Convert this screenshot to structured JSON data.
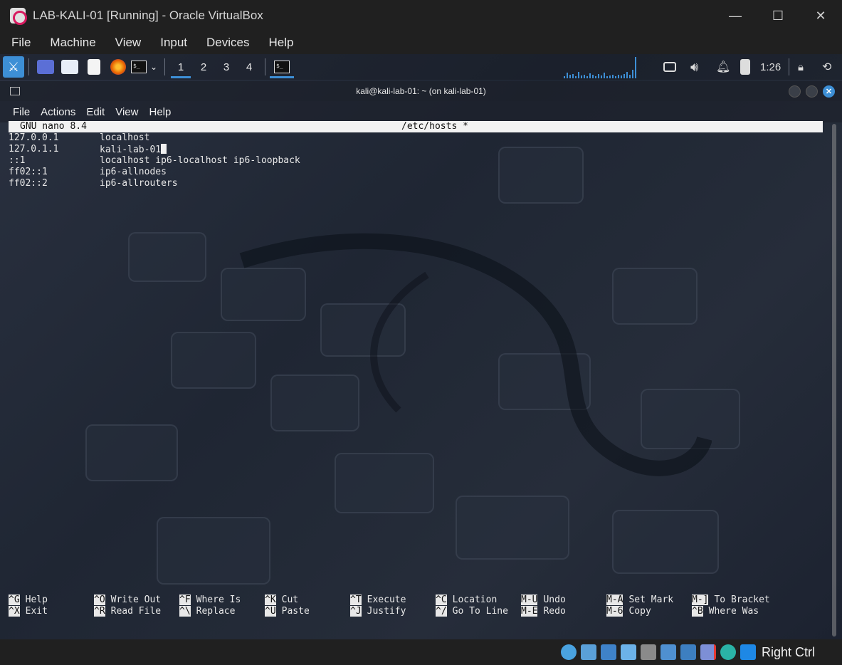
{
  "window": {
    "title": "LAB-KALI-01 [Running] - Oracle VirtualBox",
    "buttons": [
      "—",
      "☐",
      "✕"
    ]
  },
  "host_menu": [
    "File",
    "Machine",
    "View",
    "Input",
    "Devices",
    "Help"
  ],
  "panel": {
    "workspaces": [
      "1",
      "2",
      "3",
      "4"
    ],
    "clock": "1:26",
    "cpu_graph_levels": [
      0.1,
      0.25,
      0.15,
      0.2,
      0.1,
      0.3,
      0.12,
      0.18,
      0.1,
      0.22,
      0.15,
      0.1,
      0.2,
      0.14,
      0.25,
      0.1,
      0.12,
      0.18,
      0.1,
      0.15,
      0.12,
      0.2,
      0.3,
      0.15,
      0.4,
      1.0
    ]
  },
  "terminal": {
    "title": "kali@kali-lab-01: ~ (on kali-lab-01)",
    "menu": [
      "File",
      "Actions",
      "Edit",
      "View",
      "Help"
    ]
  },
  "nano": {
    "version": "GNU nano 8.4",
    "filename": "/etc/hosts *",
    "lines": [
      {
        "addr": "127.0.0.1",
        "name": "localhost"
      },
      {
        "addr": "127.0.1.1",
        "name": "kali-lab-01"
      },
      {
        "addr": "::1",
        "name": "localhost ip6-localhost ip6-loopback"
      },
      {
        "addr": "ff02::1",
        "name": "ip6-allnodes"
      },
      {
        "addr": "ff02::2",
        "name": "ip6-allrouters"
      }
    ],
    "shortcuts": [
      [
        {
          "key": "^G",
          "label": "Help"
        },
        {
          "key": "^X",
          "label": "Exit"
        }
      ],
      [
        {
          "key": "^O",
          "label": "Write Out"
        },
        {
          "key": "^R",
          "label": "Read File"
        }
      ],
      [
        {
          "key": "^F",
          "label": "Where Is"
        },
        {
          "key": "^\\",
          "label": "Replace"
        }
      ],
      [
        {
          "key": "^K",
          "label": "Cut"
        },
        {
          "key": "^U",
          "label": "Paste"
        }
      ],
      [
        {
          "key": "^T",
          "label": "Execute"
        },
        {
          "key": "^J",
          "label": "Justify"
        }
      ],
      [
        {
          "key": "^C",
          "label": "Location"
        },
        {
          "key": "^/",
          "label": "Go To Line"
        }
      ],
      [
        {
          "key": "M-U",
          "label": "Undo"
        },
        {
          "key": "M-E",
          "label": "Redo"
        }
      ],
      [
        {
          "key": "M-A",
          "label": "Set Mark"
        },
        {
          "key": "M-6",
          "label": "Copy"
        }
      ],
      [
        {
          "key": "M-]",
          "label": "To Bracket"
        },
        {
          "key": "^B",
          "label": "Where Was"
        }
      ]
    ]
  },
  "status": {
    "host_key": "Right Ctrl"
  },
  "colors": {
    "accent": "#3d8fd6",
    "vbox_red": "#d81b60"
  }
}
